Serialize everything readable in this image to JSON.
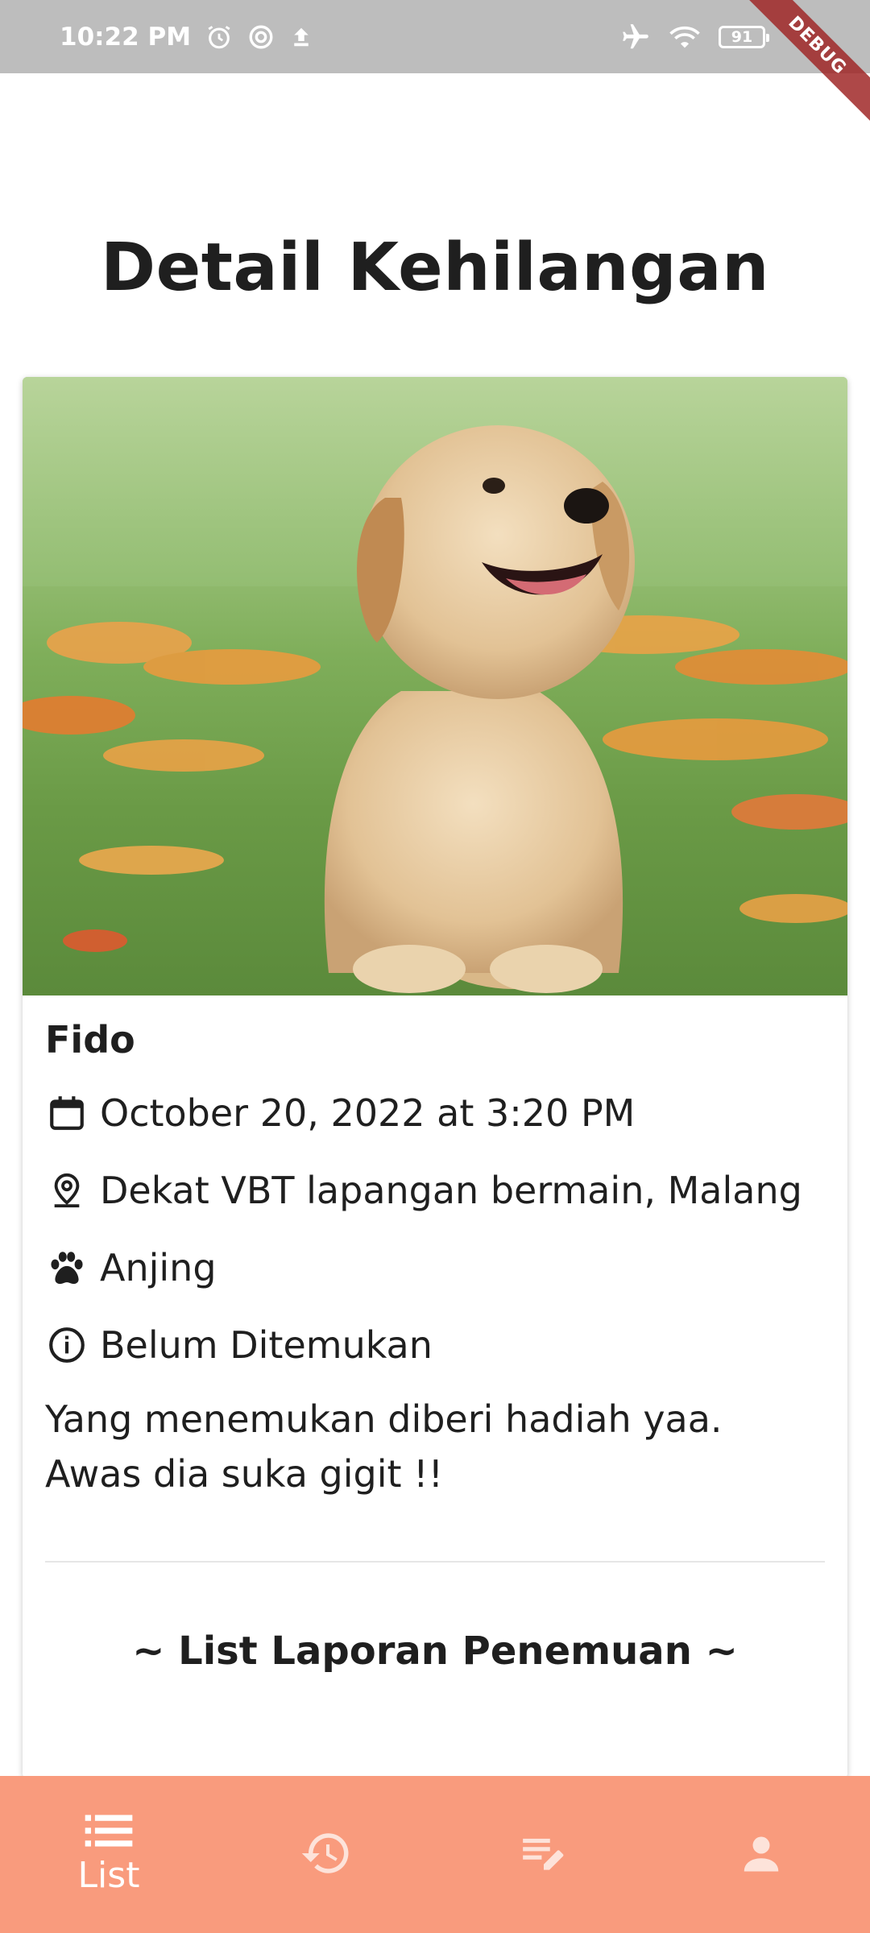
{
  "status_bar": {
    "time": "10:22 PM",
    "battery": "91",
    "icons": [
      "alarm-icon",
      "sync-icon",
      "upload-icon",
      "airplane-mode-icon",
      "wifi-icon",
      "battery-icon"
    ]
  },
  "debug_banner": "DEBUG",
  "page": {
    "title": "Detail Kehilangan"
  },
  "pet": {
    "name": "Fido",
    "date": "October 20, 2022 at 3:20 PM",
    "location": "Dekat VBT lapangan bermain, Malang",
    "type": "Anjing",
    "status": "Belum Ditemukan",
    "description": "Yang menemukan diberi hadiah yaa. Awas dia suka gigit !!",
    "photo_icon": "dog-photo"
  },
  "section": {
    "found_reports_title": "~ List Laporan Penemuan ~"
  },
  "bottom_nav": {
    "items": [
      {
        "label": "List",
        "icon": "list-icon",
        "active": true
      },
      {
        "label": "",
        "icon": "history-icon",
        "active": false
      },
      {
        "label": "",
        "icon": "edit-note-icon",
        "active": false
      },
      {
        "label": "",
        "icon": "person-icon",
        "active": false
      }
    ]
  },
  "colors": {
    "nav_background": "#f99b7d",
    "status_bar": "#bdbdbd",
    "text": "#1f1f1f"
  }
}
